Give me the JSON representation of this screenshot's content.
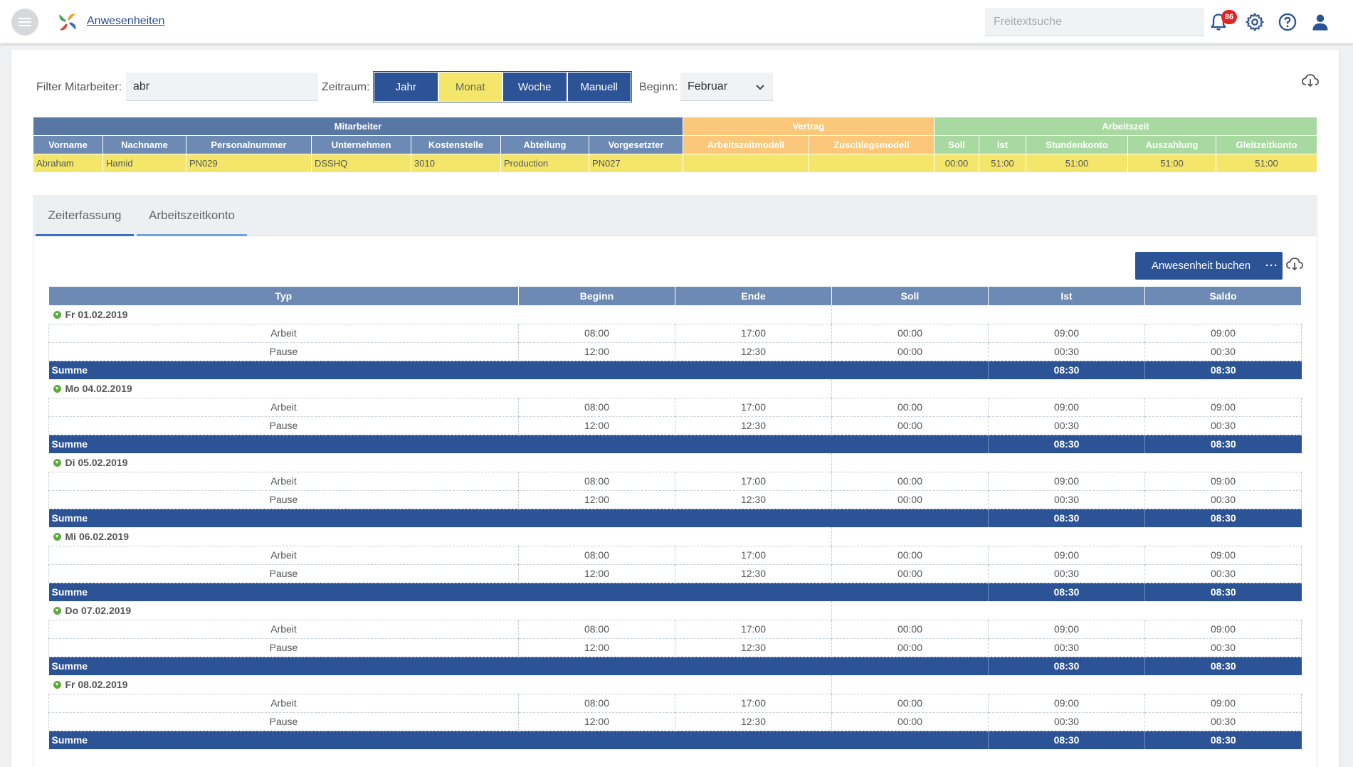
{
  "app": {
    "title": "Anwesenheiten",
    "search_placeholder": "Freitextsuche",
    "notification_count": "86"
  },
  "filters": {
    "employee_label": "Filter Mitarbeiter:",
    "employee_value": "abr",
    "period_label": "Zeitraum:",
    "period_options": [
      "Jahr",
      "Monat",
      "Woche",
      "Manuell"
    ],
    "period_selected": "Monat",
    "start_label": "Beginn:",
    "start_value": "Februar"
  },
  "employee_table": {
    "groups": {
      "mitarbeiter": "Mitarbeiter",
      "vertrag": "Vertrag",
      "arbeitszeit": "Arbeitszeit"
    },
    "columns": [
      "Vorname",
      "Nachname",
      "Personalnummer",
      "Unternehmen",
      "Kostenstelle",
      "Abteilung",
      "Vorgesetzter",
      "Arbeitszeitmodell",
      "Zuschlagsmodell",
      "Soll",
      "Ist",
      "Stundenkonto",
      "Auszahlung",
      "Gleitzeitkonto"
    ],
    "row": [
      "Abraham",
      "Hamid",
      "PN029",
      "DSSHQ",
      "3010",
      "Production",
      "PN027",
      "",
      "",
      "00:00",
      "51:00",
      "51:00",
      "51:00",
      "51:00"
    ]
  },
  "tabs": [
    "Zeiterfassung",
    "Arbeitszeitkonto"
  ],
  "actions": {
    "book_label": "Anwesenheit buchen",
    "more_label": "···"
  },
  "time_table": {
    "columns": [
      "Typ",
      "Beginn",
      "Ende",
      "Soll",
      "Ist",
      "Saldo"
    ],
    "sum_label": "Summe",
    "days": [
      {
        "date": "Fr 01.02.2019",
        "entries": [
          [
            "Arbeit",
            "08:00",
            "17:00",
            "00:00",
            "09:00",
            "09:00"
          ],
          [
            "Pause",
            "12:00",
            "12:30",
            "00:00",
            "00:30",
            "00:30"
          ]
        ],
        "sum_ist": "08:30",
        "sum_saldo": "08:30"
      },
      {
        "date": "Mo 04.02.2019",
        "entries": [
          [
            "Arbeit",
            "08:00",
            "17:00",
            "00:00",
            "09:00",
            "09:00"
          ],
          [
            "Pause",
            "12:00",
            "12:30",
            "00:00",
            "00:30",
            "00:30"
          ]
        ],
        "sum_ist": "08:30",
        "sum_saldo": "08:30"
      },
      {
        "date": "Di 05.02.2019",
        "entries": [
          [
            "Arbeit",
            "08:00",
            "17:00",
            "00:00",
            "09:00",
            "09:00"
          ],
          [
            "Pause",
            "12:00",
            "12:30",
            "00:00",
            "00:30",
            "00:30"
          ]
        ],
        "sum_ist": "08:30",
        "sum_saldo": "08:30"
      },
      {
        "date": "Mi 06.02.2019",
        "entries": [
          [
            "Arbeit",
            "08:00",
            "17:00",
            "00:00",
            "09:00",
            "09:00"
          ],
          [
            "Pause",
            "12:00",
            "12:30",
            "00:00",
            "00:30",
            "00:30"
          ]
        ],
        "sum_ist": "08:30",
        "sum_saldo": "08:30"
      },
      {
        "date": "Do 07.02.2019",
        "entries": [
          [
            "Arbeit",
            "08:00",
            "17:00",
            "00:00",
            "09:00",
            "09:00"
          ],
          [
            "Pause",
            "12:00",
            "12:30",
            "00:00",
            "00:30",
            "00:30"
          ]
        ],
        "sum_ist": "08:30",
        "sum_saldo": "08:30"
      },
      {
        "date": "Fr 08.02.2019",
        "entries": [
          [
            "Arbeit",
            "08:00",
            "17:00",
            "00:00",
            "09:00",
            "09:00"
          ],
          [
            "Pause",
            "12:00",
            "12:30",
            "00:00",
            "00:30",
            "00:30"
          ]
        ],
        "sum_ist": "08:30",
        "sum_saldo": "08:30"
      }
    ]
  },
  "colors": {
    "primary": "#2c5396",
    "highlight": "#f3e66a",
    "header": "#6c8ab3",
    "vertrag": "#fbc77a",
    "arbeitszeit": "#a8d9a0",
    "badge": "#e02424"
  },
  "icons": [
    "menu-icon",
    "logo-icon",
    "bell-icon",
    "gear-icon",
    "help-icon",
    "user-icon",
    "chevron-down-icon",
    "cloud-download-icon",
    "expand-icon"
  ]
}
